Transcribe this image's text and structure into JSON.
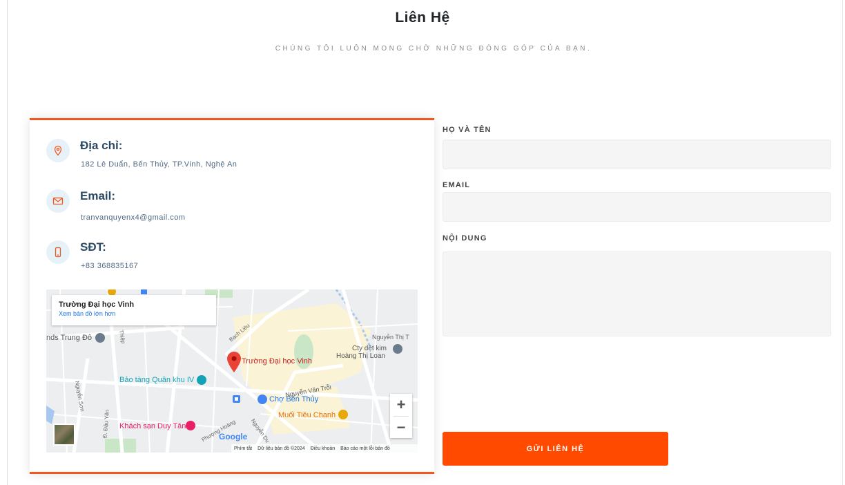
{
  "header": {
    "title": "Liên Hệ",
    "subtitle": "CHÚNG TÔI LUÔN MONG CHỜ NHỮNG ĐÓNG GÓP CỦA BẠN."
  },
  "contact_info": {
    "address": {
      "label": "Địa chỉ:",
      "value": "182 Lê Duẩn, Bến Thủy, TP.Vinh, Nghệ An",
      "icon": "map-pin-icon"
    },
    "email": {
      "label": "Email:",
      "value": "tranvanquyenx4@gmail.com",
      "icon": "envelope-icon"
    },
    "phone": {
      "label": "SĐT:",
      "value": "+83 368835167",
      "icon": "phone-icon"
    }
  },
  "map": {
    "place_name": "Trường Đại học Vinh",
    "larger_map_link": "Xem bản đồ lớn hơn",
    "labels": {
      "marker": "Trường Đại học Vinh",
      "museum": "Bảo tàng Quân khu IV",
      "market": "Chợ Bến Thủy",
      "restaurant": "Muối Tiêu Chanh",
      "hotel": "Khách sạn Duy Tân",
      "factory_line1": "Cty dệt kim",
      "factory_line2": "Hoàng Thị Loan",
      "left_edge": "nds Trung Đô",
      "street_nguyen_van_troi": "Nguyễn Văn Trỗi",
      "street_nguyen_thi": "Nguyễn Thị T",
      "street_bach_lieu": "Bạch Liêu",
      "street_phuong_hoang": "Phượng Hoàng",
      "street_nguyen_du": "Nguyễn Du",
      "street_nguyen_son": "Nguyễn Sơn",
      "street_dau_yen": "Đ. Đậu Yên",
      "street_thiep": "Thiệp"
    },
    "zoom_in": "+",
    "zoom_out": "−",
    "google_logo": "Google",
    "footer": {
      "shortcuts": "Phím tắt",
      "map_data": "Dữ liệu bản đồ ©2024",
      "terms": "Điều khoản",
      "report": "Báo cáo một lỗi bản đồ"
    },
    "colors": {
      "marker": "#ea4335",
      "museum": "#12a4b5",
      "market": "#4285f4",
      "restaurant": "#e8710a",
      "hotel": "#e91e63"
    }
  },
  "form": {
    "name_label": "HỌ VÀ TÊN",
    "name_value": "",
    "email_label": "EMAIL",
    "email_value": "",
    "message_label": "NỘI DUNG",
    "message_value": "",
    "submit_label": "GỬI LIÊN HỆ"
  },
  "colors": {
    "accent": "#ff4a00",
    "card_border": "#f0571f",
    "heading": "#2c4964",
    "icon_bg": "#e6f2f8"
  }
}
